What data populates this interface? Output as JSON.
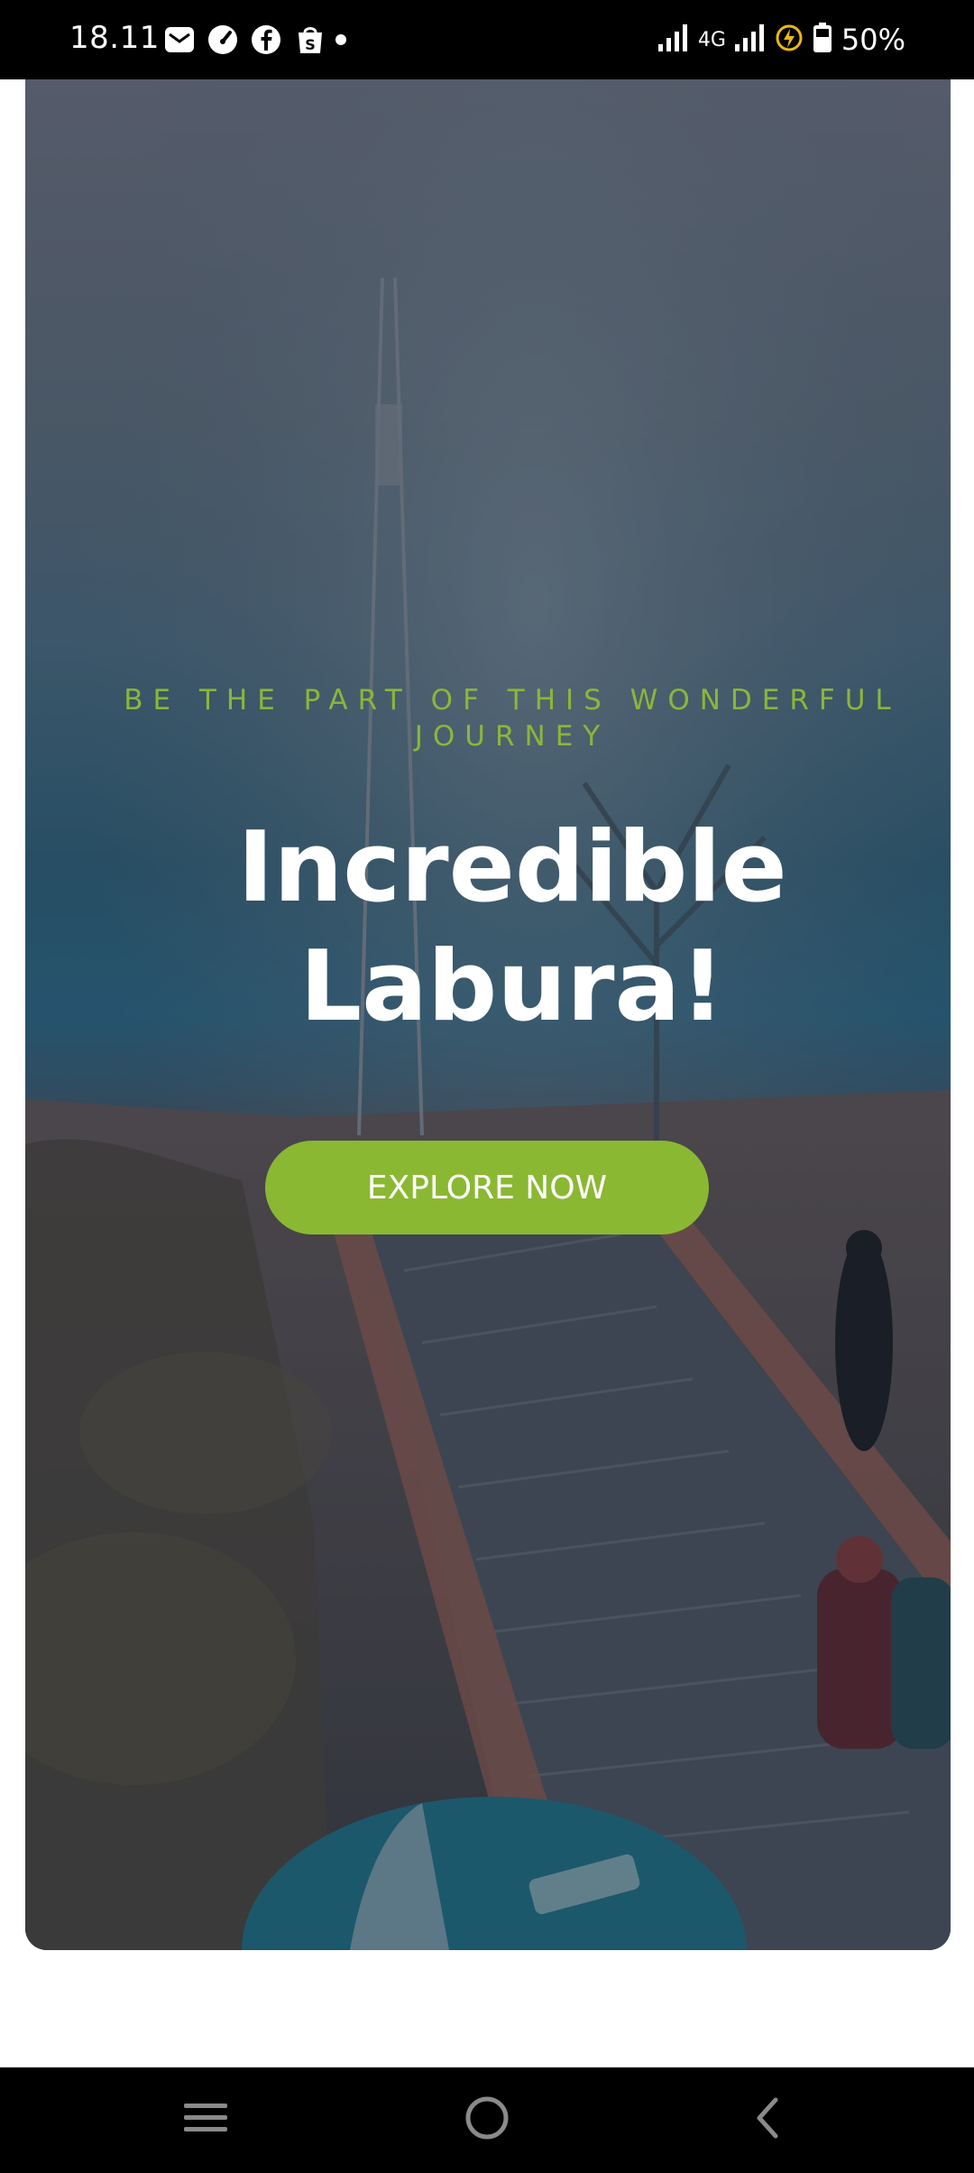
{
  "status_bar": {
    "time": "18.11",
    "network": "4G",
    "battery": "50%",
    "icons": [
      "email-icon",
      "speedometer-icon",
      "facebook-icon",
      "shopping-bag-icon",
      "notification-dot-icon",
      "signal-icon",
      "signal-icon",
      "battery-saver-icon",
      "battery-icon"
    ]
  },
  "hero": {
    "tagline": "BE THE PART OF THIS WONDERFUL JOURNEY",
    "title": "Incredible Labura!",
    "cta_label": "EXPLORE NOW",
    "accent_color": "#8ab833"
  },
  "nav_bar": {
    "buttons": [
      "menu-icon",
      "home-icon",
      "back-icon"
    ]
  }
}
